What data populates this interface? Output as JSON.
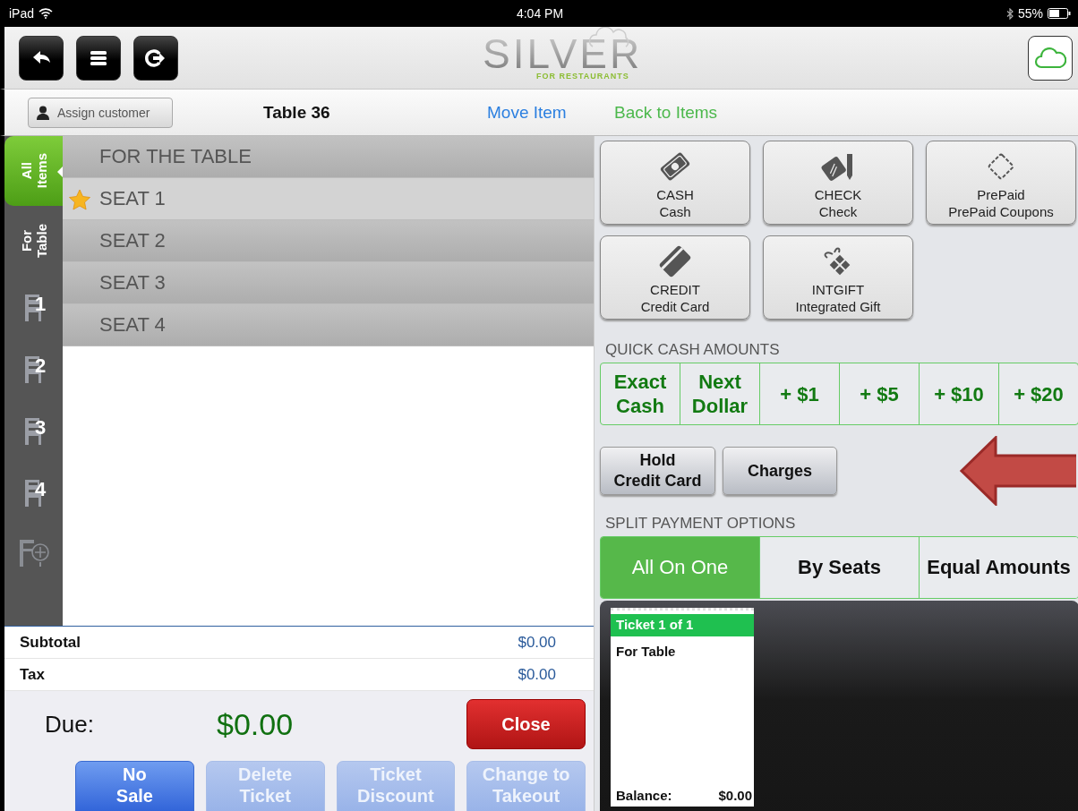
{
  "status_bar": {
    "device": "iPad",
    "time": "4:04 PM",
    "battery": "55%"
  },
  "toolbar": {
    "logo": "SILVER",
    "tagline": "FOR RESTAURANTS"
  },
  "subheader": {
    "assign_button": "Assign customer",
    "table": "Table 36",
    "move_item": "Move Item",
    "back_to_items": "Back to Items"
  },
  "side_tabs": [
    {
      "kind": "text",
      "label": "All Items",
      "selected": true
    },
    {
      "kind": "text",
      "label": "For Table",
      "selected": false
    },
    {
      "kind": "seat",
      "label": "1",
      "selected": false
    },
    {
      "kind": "seat",
      "label": "2",
      "selected": false
    },
    {
      "kind": "seat",
      "label": "3",
      "selected": false
    },
    {
      "kind": "seat",
      "label": "4",
      "selected": false
    },
    {
      "kind": "add",
      "selected": false
    }
  ],
  "seats": [
    {
      "label": "FOR THE TABLE",
      "selected": false
    },
    {
      "label": "SEAT 1",
      "selected": true
    },
    {
      "label": "SEAT 2",
      "selected": false
    },
    {
      "label": "SEAT 3",
      "selected": false
    },
    {
      "label": "SEAT 4",
      "selected": false
    }
  ],
  "totals": [
    {
      "label": "Subtotal",
      "value": "$0.00"
    },
    {
      "label": "Tax",
      "value": "$0.00"
    }
  ],
  "due": {
    "label": "Due:",
    "amount": "$0.00"
  },
  "close_button": "Close",
  "actions": [
    {
      "label": "No\nSale",
      "disabled": false
    },
    {
      "label": "Delete\nTicket",
      "disabled": true
    },
    {
      "label": "Ticket\nDiscount",
      "disabled": true
    },
    {
      "label": "Change to\nTakeout",
      "disabled": true
    }
  ],
  "payment_methods": [
    {
      "code": "CASH",
      "name": "Cash"
    },
    {
      "code": "CHECK",
      "name": "Check"
    },
    {
      "code": "PrePaid",
      "name": "PrePaid Coupons"
    },
    {
      "code": "CREDIT",
      "name": "Credit Card"
    },
    {
      "code": "INTGIFT",
      "name": "Integrated Gift"
    }
  ],
  "quick_cash": {
    "title": "QUICK CASH AMOUNTS",
    "buttons": [
      "Exact\nCash",
      "Next\nDollar",
      "+ $1",
      "+ $5",
      "+ $10",
      "+ $20"
    ]
  },
  "extra_buttons": [
    "Hold\nCredit Card",
    "Charges"
  ],
  "split_payment": {
    "title": "SPLIT PAYMENT OPTIONS",
    "options": [
      {
        "label": "All On One",
        "selected": true
      },
      {
        "label": "By Seats",
        "selected": false
      },
      {
        "label": "Equal Amounts",
        "selected": false
      }
    ]
  },
  "tickets": [
    {
      "title": "Ticket 1 of 1",
      "seat": "For Table",
      "balance_label": "Balance:",
      "balance": "$0.00"
    }
  ]
}
